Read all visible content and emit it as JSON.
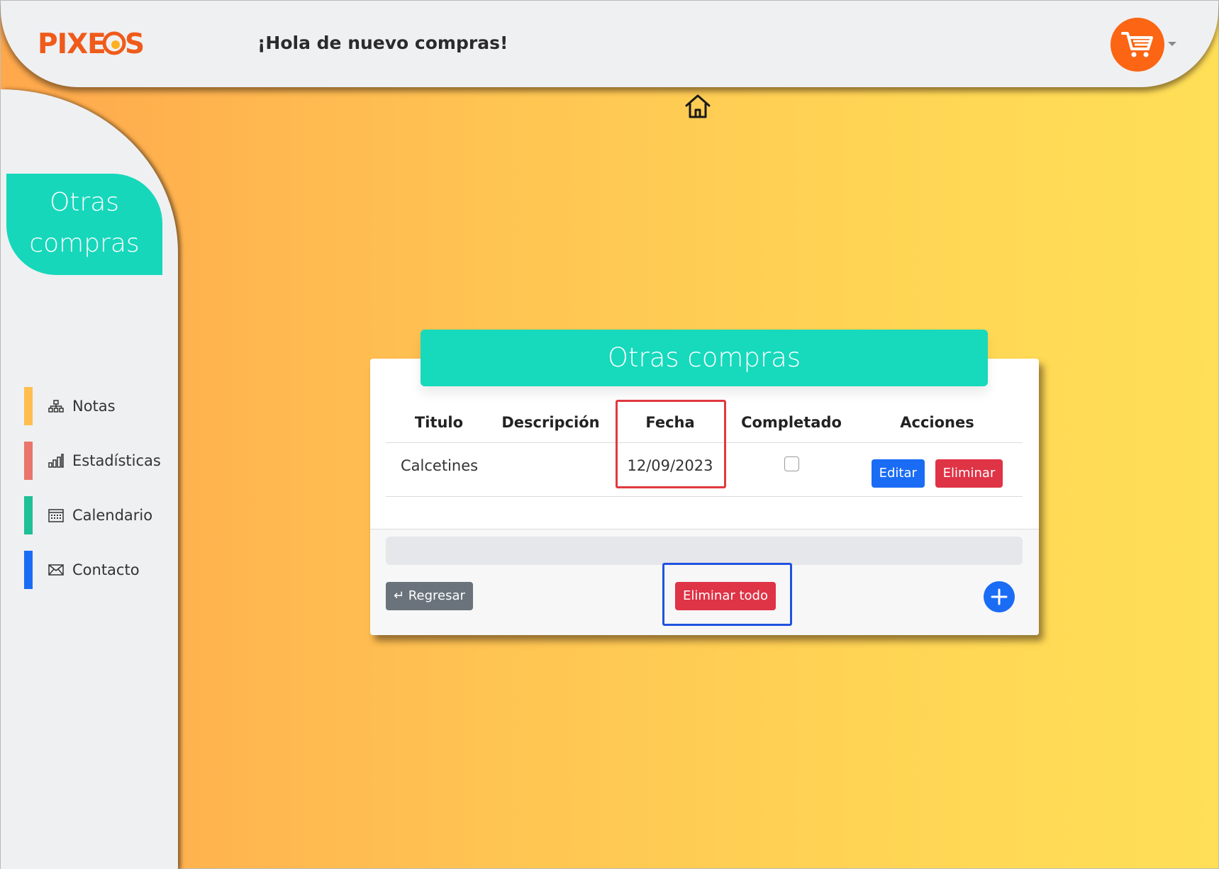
{
  "header": {
    "logo": "PIXEOS",
    "greeting": "¡Hola de nuevo compras!"
  },
  "sidebar": {
    "title": "Otras compras",
    "items": [
      {
        "label": "Notas",
        "color": "#ffbe4f",
        "icon": "sitemap-icon"
      },
      {
        "label": "Estadísticas",
        "color": "#e9756b",
        "icon": "bar-chart-icon"
      },
      {
        "label": "Calendario",
        "color": "#1fbf97",
        "icon": "calendar-icon"
      },
      {
        "label": "Contacto",
        "color": "#1b6cf5",
        "icon": "envelope-icon"
      }
    ]
  },
  "card": {
    "title": "Otras compras",
    "columns": [
      "Titulo",
      "Descripción",
      "Fecha",
      "Completado",
      "Acciones"
    ],
    "rows": [
      {
        "titulo": "Calcetines",
        "descripcion": "",
        "fecha": "12/09/2023",
        "completado": false
      }
    ],
    "edit_label": "Editar",
    "delete_label": "Eliminar",
    "back_label": "↵ Regresar",
    "delete_all_label": "Eliminar todo"
  },
  "colors": {
    "accent_teal": "#17d9bc",
    "cart_orange": "#fb6513",
    "primary_blue": "#1b6cf5",
    "danger_red": "#df3346"
  }
}
